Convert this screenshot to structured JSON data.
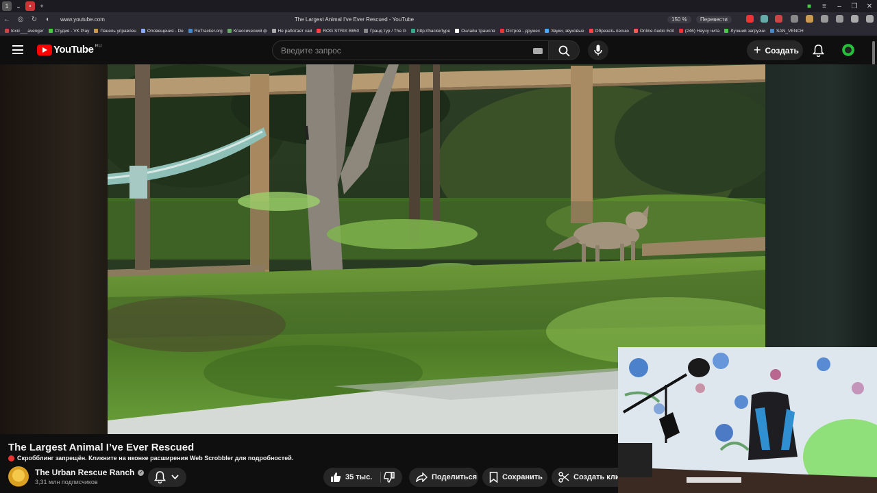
{
  "browser": {
    "url": "www.youtube.com",
    "page_title": "The Largest Animal I've Ever Rescued - YouTube",
    "zoom": "150 %",
    "translate_label": "Перевести",
    "bookmarks": [
      "toxic___avenger",
      "Студия - VK Play",
      "Панель управлен",
      "Оповещения - De",
      "RuTracker.org",
      "Классический ф",
      "Не работает сай",
      "ROG STRIX B650",
      "Гранд тур / The G",
      "http://hackertype",
      "Онлайн трансля",
      "Остров - дружес",
      "Звуки, звуковые",
      "Обрезать песню",
      "Online Audio Edit",
      "(246) Научу чита",
      "Лучший загрузчи",
      "SAN_VENCH"
    ]
  },
  "header": {
    "logo_text": "YouTube",
    "country_code": "RU",
    "search_placeholder": "Введите запрос",
    "create_label": "Создать"
  },
  "video": {
    "title": "The Largest Animal I’ve Ever Rescued",
    "scrobbler_notice": "Скробблинг запрещён. Кликните на иконке расширения Web Scrobbler для подробностей."
  },
  "channel": {
    "name": "The Urban Rescue Ranch",
    "subscribers": "3,31 млн подписчиков"
  },
  "actions": {
    "likes": "35 тыс.",
    "share_label": "Поделиться",
    "save_label": "Сохранить",
    "clip_label": "Создать клип"
  }
}
